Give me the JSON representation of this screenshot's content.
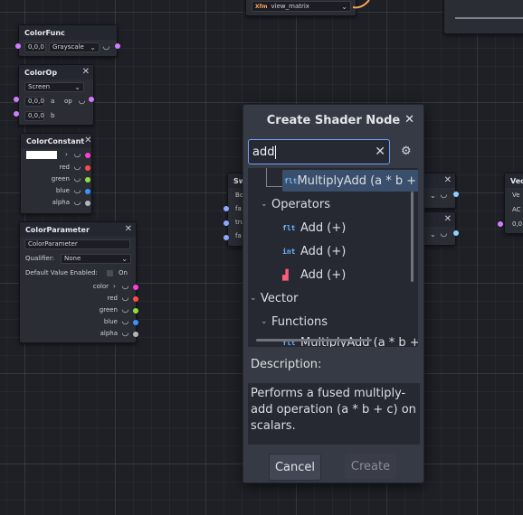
{
  "top_node": {
    "icon": "Xfm",
    "value": "view_matrix"
  },
  "color_func": {
    "title": "ColorFunc",
    "value": "0,0,0",
    "func": "Grayscale"
  },
  "color_op": {
    "title": "ColorOp",
    "op_select": "Screen",
    "rows": [
      {
        "value": "0,0,0",
        "label": "a",
        "out": "op"
      },
      {
        "value": "0,0,0",
        "label": "b"
      }
    ]
  },
  "color_constant": {
    "title": "ColorConstant",
    "outputs": [
      "red",
      "green",
      "blue",
      "alpha"
    ]
  },
  "color_parameter": {
    "title": "ColorParameter",
    "name": "ColorParameter",
    "qualifier_label": "Qualifier:",
    "qualifier": "None",
    "default_label": "Default Value Enabled:",
    "default_toggle": "On",
    "outputs": [
      "color",
      "red",
      "green",
      "blue",
      "alpha"
    ]
  },
  "partial_nodes": {
    "sw_title": "Sw",
    "sw_rows": [
      "Bo",
      "fa",
      "tru",
      "fa"
    ],
    "vec_title": "Vec",
    "vec_rows": [
      "Ve",
      "AC",
      "0,0"
    ]
  },
  "port_colors": {
    "color": "#ff3fd9",
    "red": "#ff4a4a",
    "green": "#8fe03b",
    "blue": "#3a94ff",
    "alpha": "#b6b6b6",
    "vector": "#d27cff",
    "scalar": "#8fd0ff",
    "bool": "#8fa8ff"
  },
  "dialog": {
    "title": "Create Shader Node",
    "search_value": "add",
    "tree": [
      {
        "tag": "FLT",
        "label": "MultiplyAdd (a * b + c)"
      },
      {
        "label": "Operators"
      },
      {
        "tag": "FLT",
        "label": "Add (+)"
      },
      {
        "tag": "INT",
        "label": "Add (+)"
      },
      {
        "tag": "",
        "label": "Add (+)"
      },
      {
        "label": "Vector"
      },
      {
        "label": "Functions"
      },
      {
        "tag": "FLT",
        "label": "MultiplyAdd (a * b + c)"
      }
    ],
    "description_label": "Description:",
    "description": "Performs a fused multiply-add operation (a * b + c) on scalars.",
    "cancel_label": "Cancel",
    "create_label": "Create"
  }
}
